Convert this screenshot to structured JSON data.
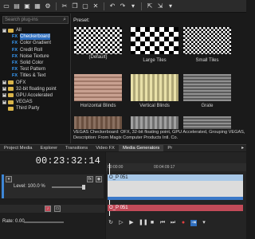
{
  "toolbar": {
    "buttons": [
      "new-icon",
      "open-icon",
      "save-icon",
      "properties-icon",
      "render-icon",
      "cut-icon",
      "copy-icon",
      "paste-icon",
      "delete-icon",
      "undo-icon",
      "redo-icon",
      "history-icon",
      "normal-edit-icon",
      "envelope-icon",
      "selection-icon"
    ]
  },
  "search": {
    "placeholder": "Search plug-ins"
  },
  "tree": {
    "items": [
      {
        "label": "All",
        "type": "folder",
        "expander": "-"
      },
      {
        "label": "Checkerboard",
        "type": "fx"
      },
      {
        "label": "Color Gradient",
        "type": "fx"
      },
      {
        "label": "Credit Roll",
        "type": "fx"
      },
      {
        "label": "Noise Texture",
        "type": "fx"
      },
      {
        "label": "Solid Color",
        "type": "fx"
      },
      {
        "label": "Test Pattern",
        "type": "fx"
      },
      {
        "label": "Titles & Text",
        "type": "fx"
      },
      {
        "label": "OFX",
        "type": "folder",
        "expander": "+"
      },
      {
        "label": "32-bit floating point",
        "type": "folder",
        "expander": "+"
      },
      {
        "label": "GPU Accelerated",
        "type": "folder",
        "expander": "+"
      },
      {
        "label": "VEGAS",
        "type": "folder",
        "expander": "+"
      },
      {
        "label": "Third Party",
        "type": "folder",
        "expander": ""
      }
    ]
  },
  "preset": {
    "title": "Preset:",
    "thumbnails": [
      {
        "label": "(Default)"
      },
      {
        "label": "Large Tiles"
      },
      {
        "label": "Small Tiles"
      },
      {
        "label": "Horizontal Blinds"
      },
      {
        "label": "Vertical Blinds"
      },
      {
        "label": "Grate"
      },
      {
        "label": ""
      },
      {
        "label": ""
      },
      {
        "label": ""
      }
    ],
    "description_line1": "VEGAS Checkerboard: OFX, 32-bit floating point, GPU Accelerated, Grouping VEGAS, Ve",
    "description_line2": "Description: From Magix Computer Products Intl. Co."
  },
  "tabs": [
    "Project Media",
    "Explorer",
    "Transitions",
    "Video FX",
    "Media Generators",
    "Pr"
  ],
  "timeline": {
    "timecode": "00:23:32:14",
    "level": "Level: 100.0 %",
    "rate": "Rate: 0.00",
    "ruler": [
      "00:00:00",
      "00:04:09:17"
    ],
    "clip_name": "O_P 051",
    "audio_clip_name": "O_P 051"
  }
}
